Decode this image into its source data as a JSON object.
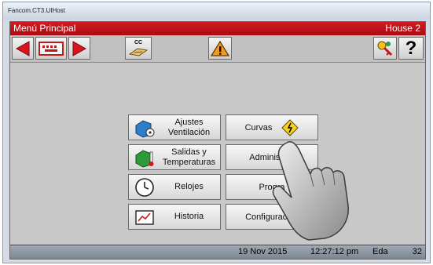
{
  "window": {
    "title": "Fancom.CT3.UIHost"
  },
  "header": {
    "title": "Menú Principal",
    "house": "House 2"
  },
  "toolbar": {
    "cc_label": "CC",
    "icons": [
      "arrow-left-icon",
      "keyboard-icon",
      "arrow-right-icon",
      "cc-icon",
      "warning-icon",
      "key-icon",
      "help-icon"
    ],
    "help_label": "?"
  },
  "menu": {
    "left": [
      {
        "label_line1": "Ajustes",
        "label_line2": "Ventilación",
        "icon": "ventilation-icon"
      },
      {
        "label_line1": "Salidas y",
        "label_line2": "Temperaturas",
        "icon": "outputs-temperature-icon"
      },
      {
        "label_line1": "Relojes",
        "label_line2": "",
        "icon": "clock-icon"
      },
      {
        "label_line1": "Historia",
        "label_line2": "",
        "icon": "history-icon"
      }
    ],
    "right": [
      {
        "label": "Curvas",
        "icon": "curve-warning-icon"
      },
      {
        "label": "Administrac"
      },
      {
        "label": "Progra"
      },
      {
        "label": "Configuración"
      }
    ]
  },
  "status": {
    "date": "19 Nov 2015",
    "time": "12:27:12 pm",
    "user": "Eda",
    "number": "32"
  },
  "colors": {
    "accent": "#c4121a",
    "screen_bg": "#c8c8c8",
    "status_bg": "#8d97a3"
  }
}
